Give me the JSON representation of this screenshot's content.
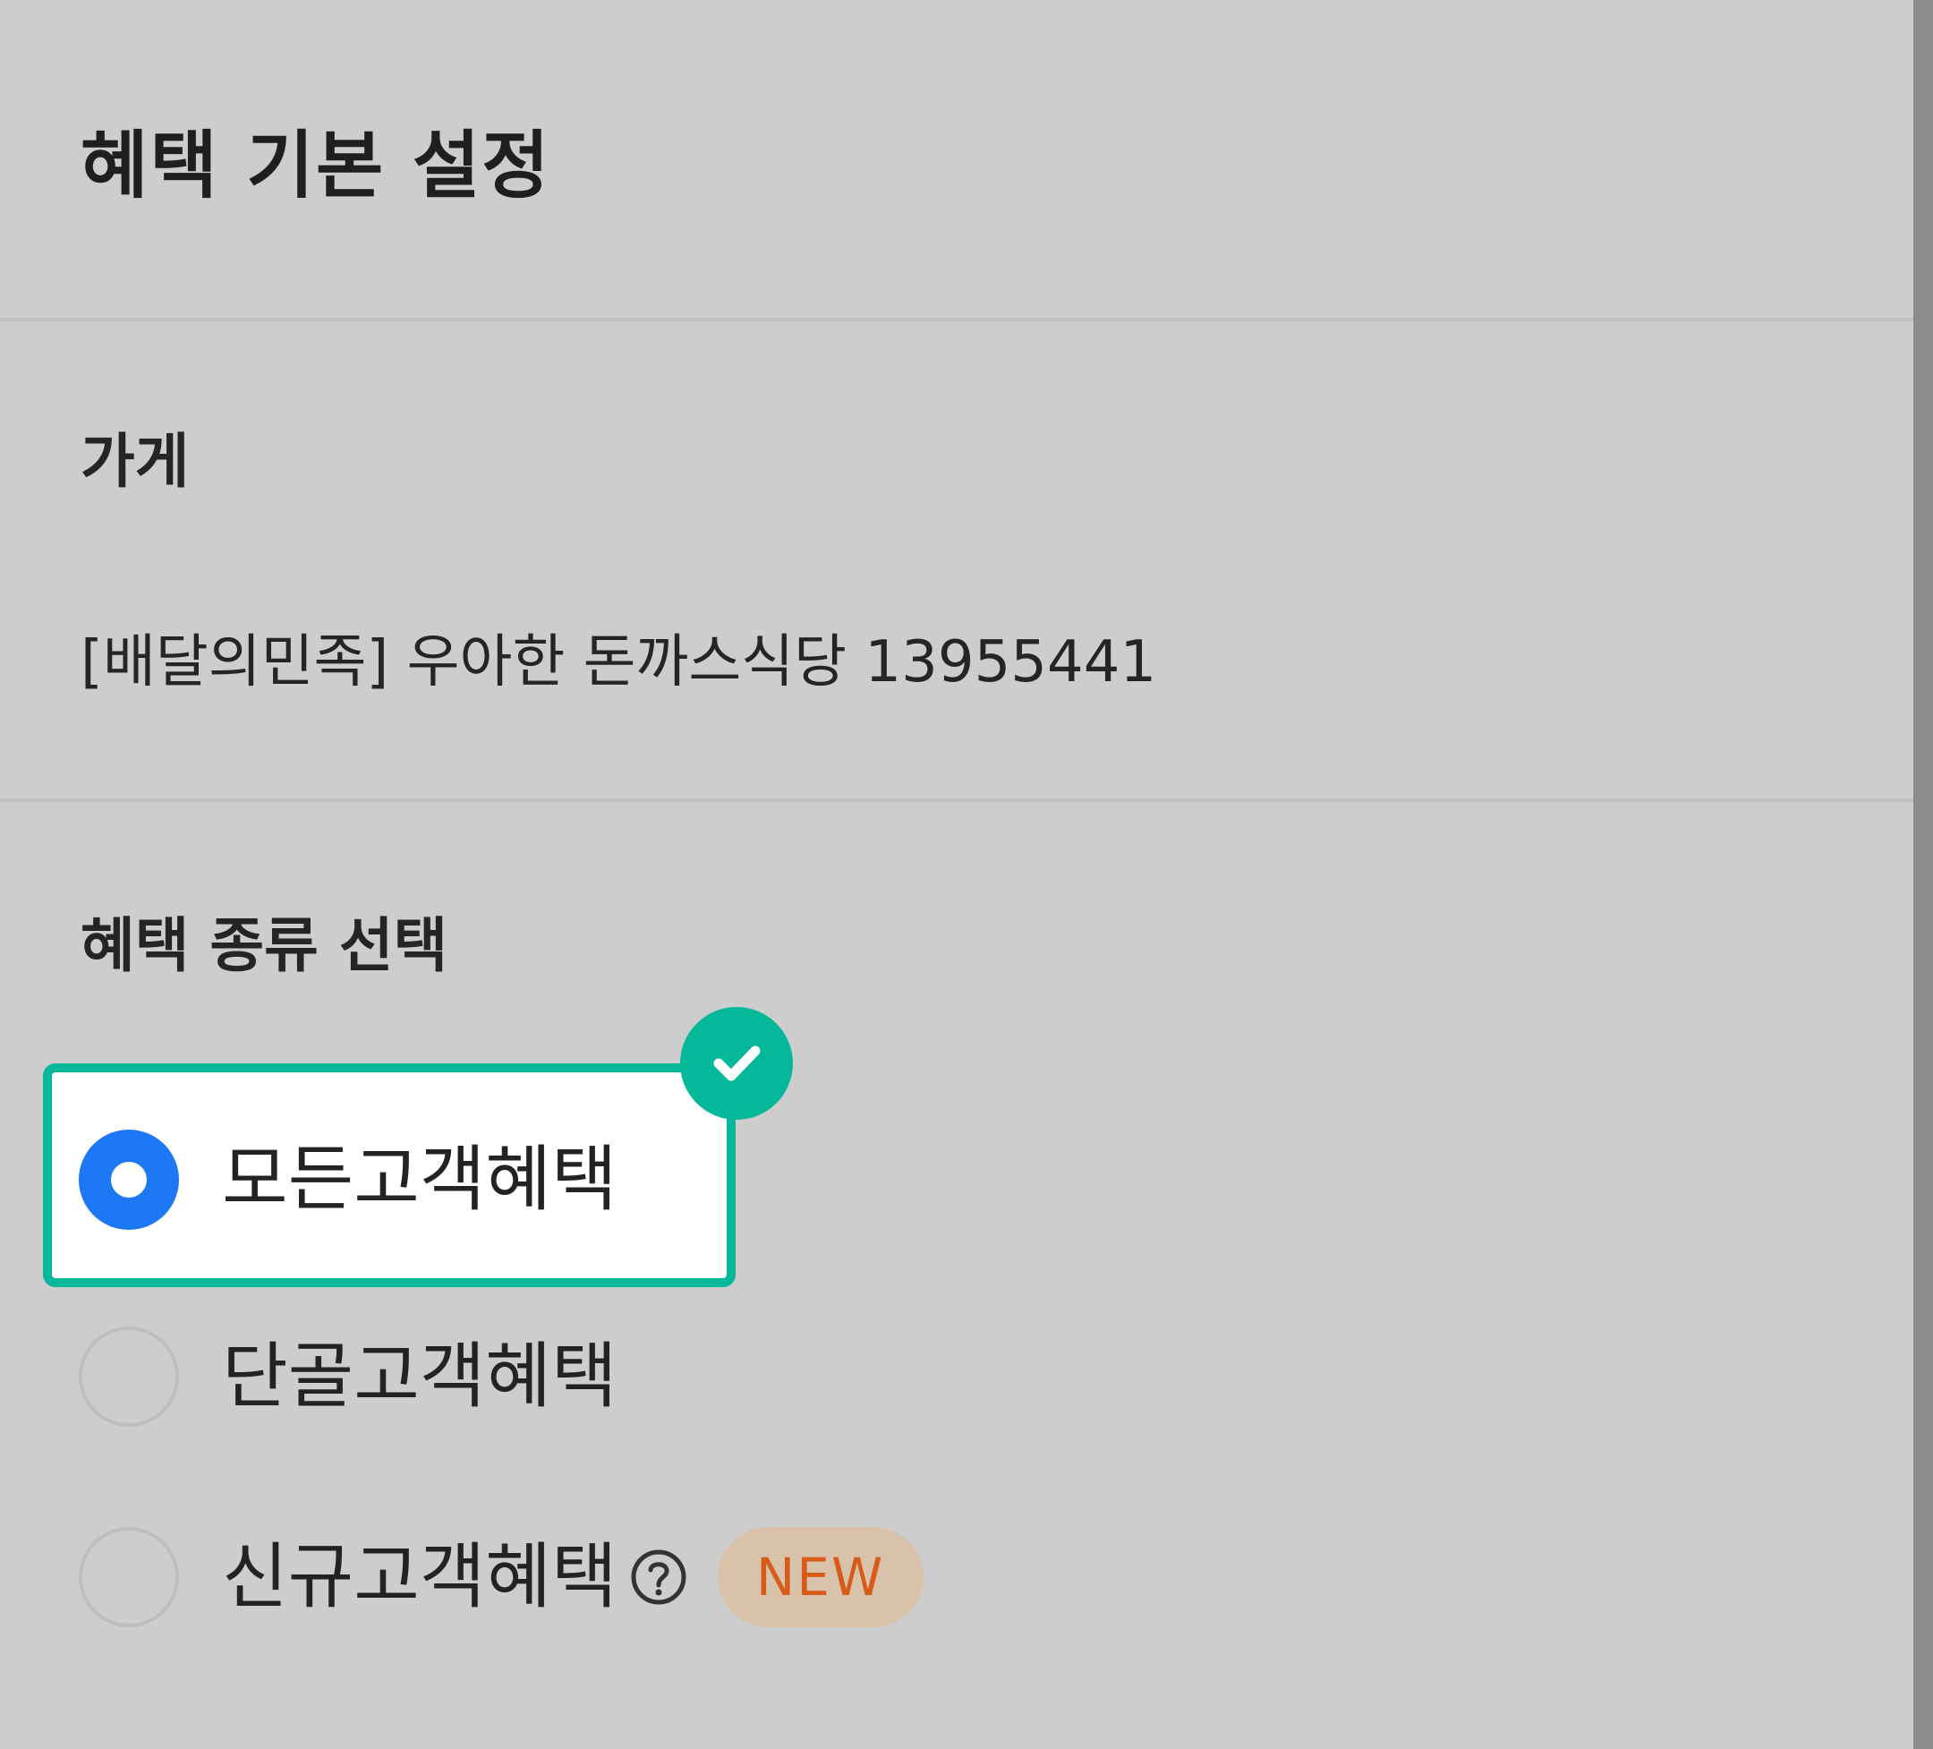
{
  "page": {
    "title": "혜택 기본 설정"
  },
  "store": {
    "label": "가게",
    "value": "[배달의민족] 우아한 돈까스식당 13955441"
  },
  "benefit_type": {
    "label": "혜택 종류 선택",
    "options": [
      {
        "label": "모든고객혜택",
        "selected": true
      },
      {
        "label": "단골고객혜택",
        "selected": false
      },
      {
        "label": "신규고객혜택",
        "selected": false,
        "help_icon": "question-circle-icon",
        "badge": "NEW"
      }
    ]
  },
  "icons": {
    "selection_check": "checkmark-icon",
    "help": "question-circle-icon"
  },
  "colors": {
    "background": "#cdcdcd",
    "highlight": "#05b89a",
    "radio_selected": "#1d78f5",
    "new_badge_background": "#d8c3aa",
    "new_badge_text": "#d95b19"
  }
}
